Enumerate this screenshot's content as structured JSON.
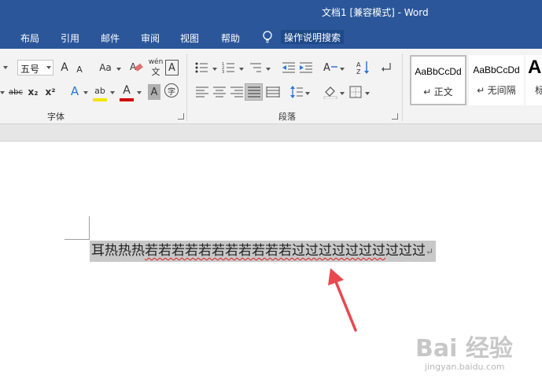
{
  "window": {
    "title": "文档1 [兼容模式]  -  Word"
  },
  "tabs": [
    "布局",
    "引用",
    "邮件",
    "审阅",
    "视图",
    "帮助"
  ],
  "tell_me": "操作说明搜索",
  "ribbon": {
    "font": {
      "font_name_partial": "",
      "font_size": "五号",
      "grow": "A",
      "shrink": "A",
      "change_case": "Aa",
      "phonetic_top": "wén",
      "phonetic_bottom": "文",
      "char_border": "A",
      "strike": "abc",
      "sub": "x₂",
      "sup": "x²",
      "text_effects": "A",
      "highlight": "ab",
      "font_color": "A",
      "char_shading": "A",
      "enclose": "字",
      "label": "字体"
    },
    "paragraph": {
      "label": "段落"
    },
    "styles": [
      {
        "sample": "AaBbCcDd",
        "name": "↵ 正文"
      },
      {
        "sample": "AaBbCcDd",
        "name": "↵ 无间隔"
      },
      {
        "sample": "A",
        "name": "标"
      }
    ]
  },
  "document": {
    "text_plain": "耳热热热",
    "text_underlined": "若若若若若若若若若若若过过过过过过过",
    "text_tail": "过过过",
    "paragraph_mark": "↵"
  },
  "watermark": {
    "brand": "Bai 经验",
    "url": "jingyan.baidu.com"
  },
  "colors": {
    "title_bar": "#2b579a",
    "highlight_bar": "#f2e600",
    "font_color_bar": "#d00000",
    "squiggle": "#e02020",
    "arrow": "#e8484e"
  }
}
